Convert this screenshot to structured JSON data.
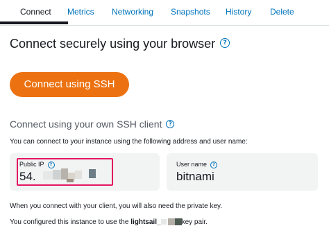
{
  "tabs": [
    {
      "label": "Connect",
      "active": true
    },
    {
      "label": "Metrics",
      "active": false
    },
    {
      "label": "Networking",
      "active": false
    },
    {
      "label": "Snapshots",
      "active": false
    },
    {
      "label": "History",
      "active": false
    },
    {
      "label": "Delete",
      "active": false
    }
  ],
  "browser_section": {
    "heading": "Connect securely using your browser",
    "help_glyph": "?",
    "button_label": "Connect using SSH"
  },
  "client_section": {
    "heading": "Connect using your own SSH client",
    "help_glyph": "?",
    "description": "You can connect to your instance using the following address and user name:"
  },
  "public_ip": {
    "label": "Public IP",
    "help_glyph": "?",
    "value_visible": "54."
  },
  "user_name": {
    "label": "User name",
    "help_glyph": "?",
    "value": "bitnami"
  },
  "notes": {
    "private_key": "When you connect with your client, you will also need the private key.",
    "configured_prefix": "You configured this instance to use the ",
    "key_name_visible": "lightsail_",
    "configured_suffix": "key pair."
  },
  "colors": {
    "accent": "#0073bb",
    "button": "#ec7211",
    "highlight": "#e3155f",
    "card_bg": "#f2f3f3"
  }
}
